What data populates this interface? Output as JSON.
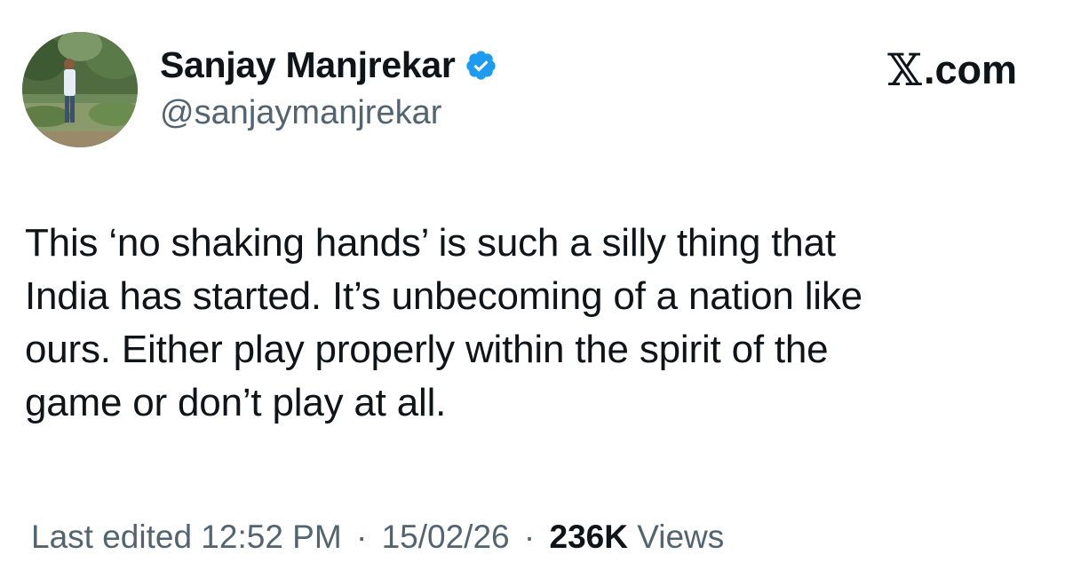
{
  "author": {
    "name": "Sanjay Manjrekar",
    "handle": "@sanjaymanjrekar",
    "verified": true,
    "verified_color": "#1d9bf0"
  },
  "brand": {
    "x_glyph": "𝕏",
    "domain": ".com"
  },
  "tweet": {
    "lines": [
      "This ‘no shaking hands’ is such a silly thing that",
      "India has started. It’s unbecoming of a nation like",
      "ours. Either play properly within the spirit of the",
      "game or don’t play at all."
    ]
  },
  "meta": {
    "edited_label": "Last edited 12:52 PM",
    "separator": "·",
    "date": "15/02/26",
    "views_count": "236K",
    "views_label": "Views"
  },
  "colors": {
    "text_primary": "#0f1419",
    "text_secondary": "#536471"
  }
}
